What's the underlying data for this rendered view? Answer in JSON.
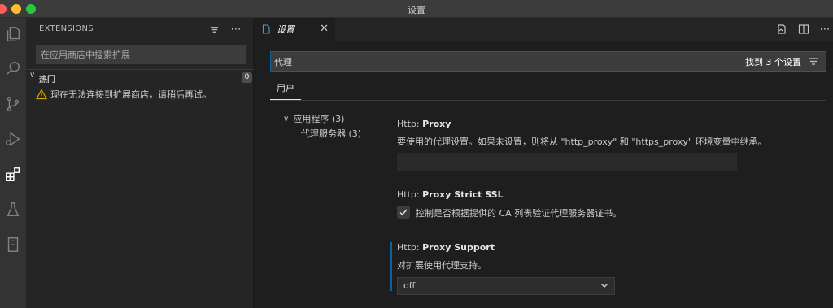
{
  "window": {
    "title": "设置"
  },
  "activity_bar": {
    "icons": [
      "explorer-icon",
      "search-icon",
      "source-control-icon",
      "run-debug-icon",
      "extensions-icon",
      "testing-icon",
      "remote-explorer-icon"
    ],
    "active": "extensions-icon"
  },
  "sidebar": {
    "title": "EXTENSIONS",
    "search_placeholder": "在应用商店中搜索扩展",
    "section": {
      "label": "热门",
      "count": "0"
    },
    "warning": "现在无法连接到扩展商店，请稍后再试。"
  },
  "editor": {
    "tab": {
      "label": "设置",
      "close": "✕"
    },
    "search": {
      "value": "代理",
      "found": "找到 3 个设置"
    },
    "scope_tab": "用户",
    "toc": {
      "group": "应用程序 (3)",
      "item": "代理服务器 (3)"
    },
    "settings": [
      {
        "category": "Http: ",
        "name": "Proxy",
        "description": "要使用的代理设置。如果未设置，则将从 \"http_proxy\" 和 \"https_proxy\" 环境变量中继承。",
        "value": ""
      },
      {
        "category": "Http: ",
        "name": "Proxy Strict SSL",
        "description": "控制是否根据提供的 CA 列表验证代理服务器证书。",
        "checked": true
      },
      {
        "category": "Http: ",
        "name": "Proxy Support",
        "description": "对扩展使用代理支持。",
        "selected": "off"
      }
    ]
  },
  "colors": {
    "accent": "#0e639c",
    "activity_bar": "#333333",
    "sidebar": "#252526",
    "editor": "#1e1e1e"
  }
}
